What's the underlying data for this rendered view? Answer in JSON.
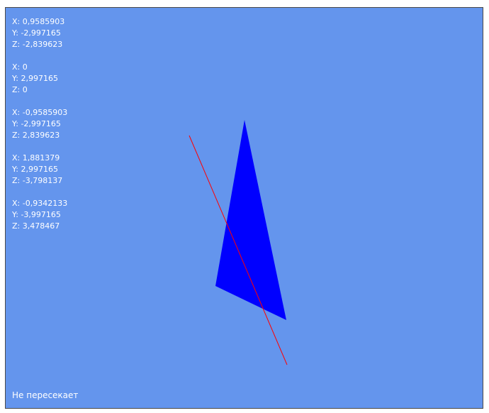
{
  "points": [
    {
      "x": "X: 0,9585903",
      "y": "Y: -2,997165",
      "z": "Z: -2,839623"
    },
    {
      "x": "X: 0",
      "y": "Y: 2,997165",
      "z": "Z: 0"
    },
    {
      "x": "X: -0,9585903",
      "y": "Y: -2,997165",
      "z": "Z: 2,839623"
    },
    {
      "x": "X: 1,881379",
      "y": "Y: 2,997165",
      "z": "Z: -3,798137"
    },
    {
      "x": "X: -0,9342133",
      "y": "Y: -3,997165",
      "z": "Z: 3,478467"
    }
  ],
  "status": "Не пересекает",
  "colors": {
    "background": "#6495ed",
    "triangle": "#0000ff",
    "line": "#ff0000",
    "text": "#ffffff"
  }
}
